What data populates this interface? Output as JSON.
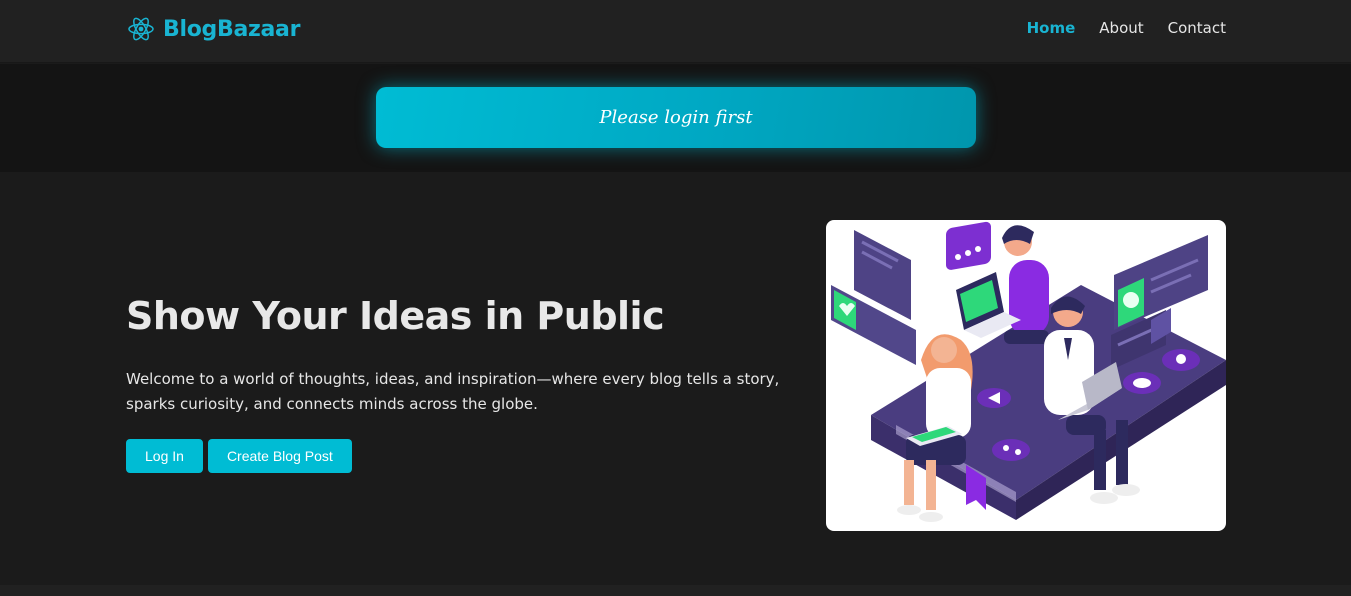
{
  "brand": {
    "name": "BlogBazaar",
    "icon": "atom-icon",
    "color": "#19b4d2"
  },
  "nav": {
    "links": [
      {
        "label": "Home",
        "active": true
      },
      {
        "label": "About",
        "active": false
      },
      {
        "label": "Contact",
        "active": false
      }
    ]
  },
  "alert": {
    "message": "Please login first",
    "color": "#00bcd4"
  },
  "hero": {
    "title": "Show Your Ideas in Public",
    "description": "Welcome to a world of thoughts, ideas, and inspiration—where every blog tells a story, sparks curiosity, and connects minds across the globe.",
    "buttons": {
      "login": "Log In",
      "create": "Create Blog Post"
    },
    "illustration": "people-collaborating-illustration"
  }
}
